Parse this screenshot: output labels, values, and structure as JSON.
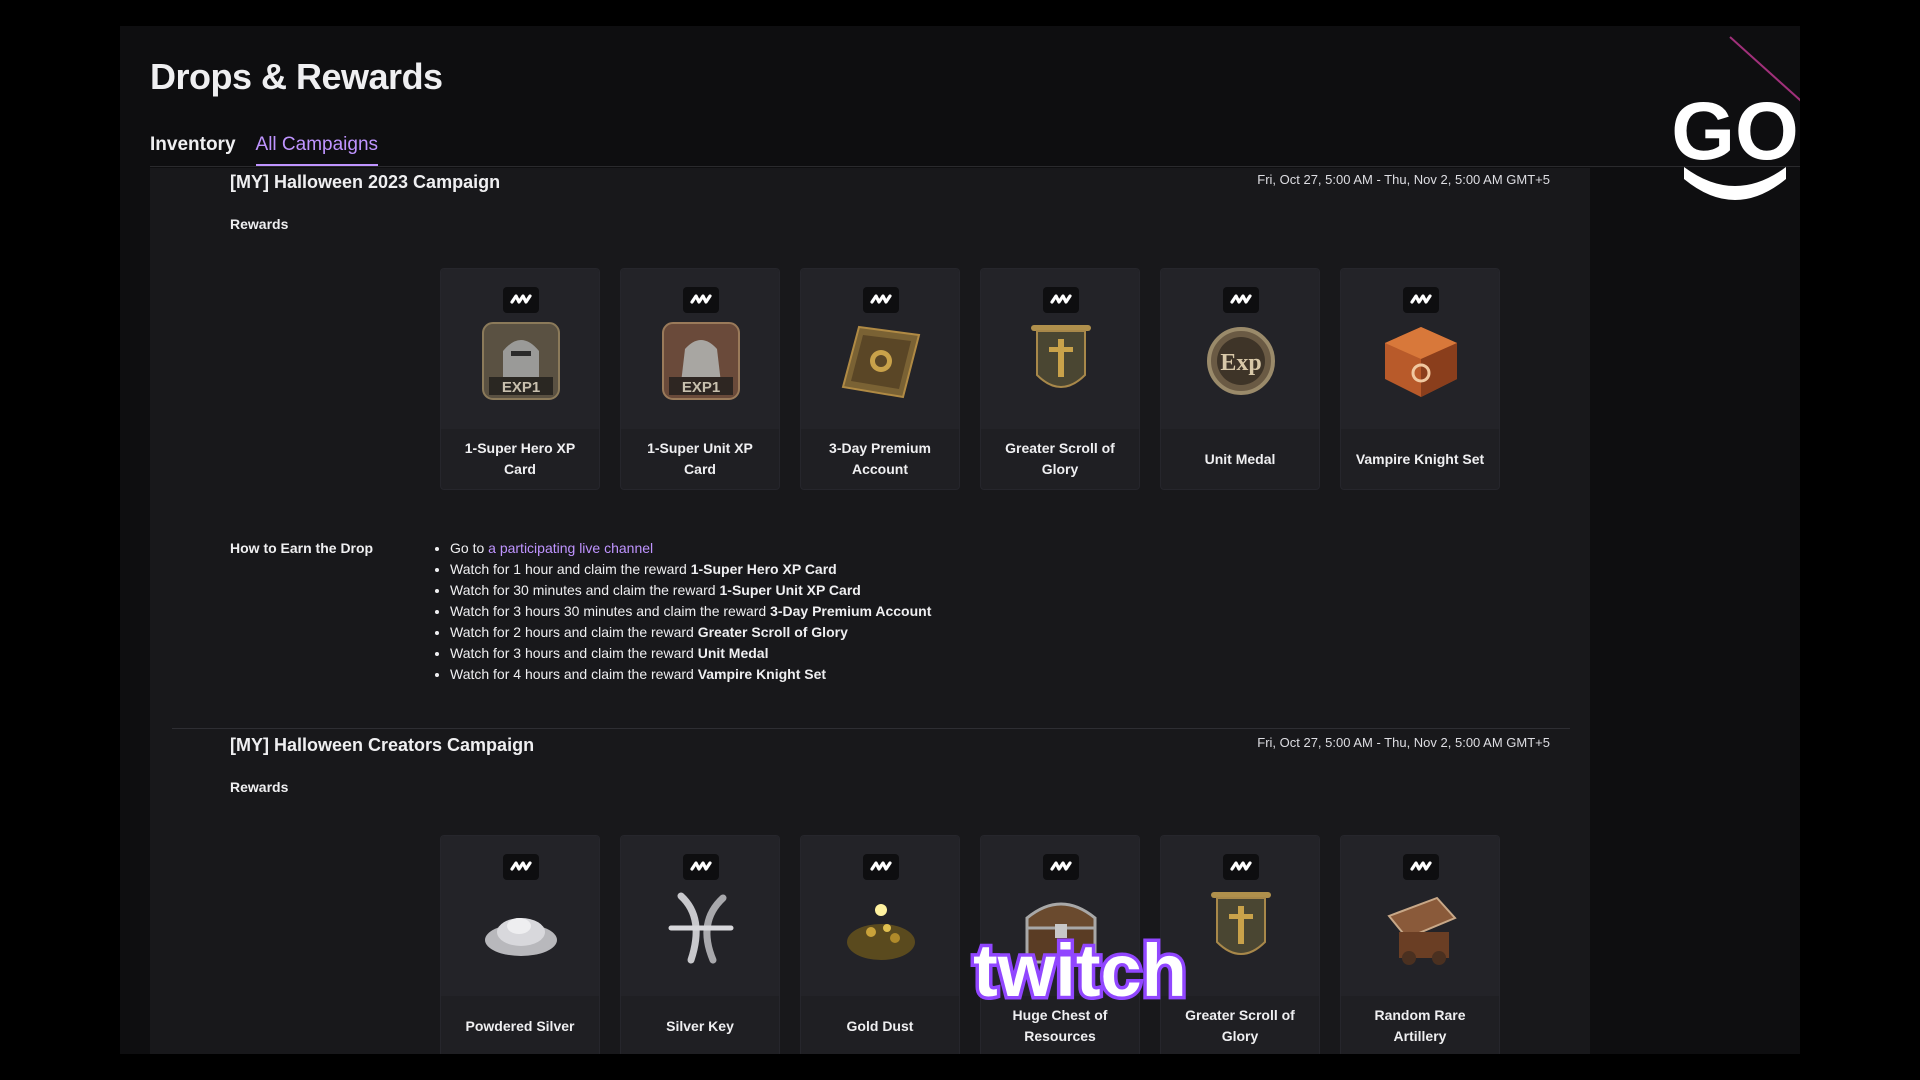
{
  "page": {
    "title": "Drops & Rewards"
  },
  "tabs": [
    {
      "label": "Inventory",
      "active": false
    },
    {
      "label": "All Campaigns",
      "active": true
    }
  ],
  "logo": {
    "text": "GO"
  },
  "campaigns": [
    {
      "title": "[MY] Halloween 2023 Campaign",
      "dates": "Fri, Oct 27, 5:00 AM - Thu, Nov 2, 5:00 AM GMT+5",
      "rewards_label": "Rewards",
      "rewards": [
        {
          "name": "1-Super Hero XP Card",
          "icon": "hero-xp-card-icon"
        },
        {
          "name": "1-Super Unit XP Card",
          "icon": "unit-xp-card-icon"
        },
        {
          "name": "3-Day Premium Account",
          "icon": "premium-account-icon"
        },
        {
          "name": "Greater Scroll of Glory",
          "icon": "scroll-of-glory-icon"
        },
        {
          "name": "Unit Medal",
          "icon": "unit-medal-icon"
        },
        {
          "name": "Vampire Knight Set",
          "icon": "vampire-knight-set-icon"
        }
      ],
      "how_to_label": "How to Earn the Drop",
      "how_to": {
        "first_prefix": "Go to ",
        "first_link": "a participating live channel",
        "steps": [
          {
            "text": "Watch for 1 hour and claim the reward ",
            "reward": "1-Super Hero XP Card"
          },
          {
            "text": "Watch for 30 minutes and claim the reward ",
            "reward": "1-Super Unit XP Card"
          },
          {
            "text": "Watch for 3 hours 30 minutes and claim the reward ",
            "reward": "3-Day Premium Account"
          },
          {
            "text": "Watch for 2 hours and claim the reward ",
            "reward": "Greater Scroll of Glory"
          },
          {
            "text": "Watch for 3 hours and claim the reward ",
            "reward": "Unit Medal"
          },
          {
            "text": "Watch for 4 hours and claim the reward ",
            "reward": "Vampire Knight Set"
          }
        ]
      }
    },
    {
      "title": "[MY] Halloween Creators Campaign",
      "dates": "Fri, Oct 27, 5:00 AM - Thu, Nov 2, 5:00 AM GMT+5",
      "rewards_label": "Rewards",
      "rewards": [
        {
          "name": "Powdered Silver",
          "icon": "powdered-silver-icon"
        },
        {
          "name": "Silver Key",
          "icon": "silver-key-icon"
        },
        {
          "name": "Gold Dust",
          "icon": "gold-dust-icon"
        },
        {
          "name": "Huge Chest of Resources",
          "icon": "chest-icon"
        },
        {
          "name": "Greater Scroll of Glory",
          "icon": "scroll-of-glory-icon"
        },
        {
          "name": "Random Rare Artillery",
          "icon": "artillery-icon"
        }
      ]
    }
  ],
  "watermark": {
    "text": "twitch",
    "color": "#9146ff"
  },
  "colors": {
    "accent": "#bf94ff",
    "background": "#0e0e10",
    "panel": "#18181b"
  }
}
